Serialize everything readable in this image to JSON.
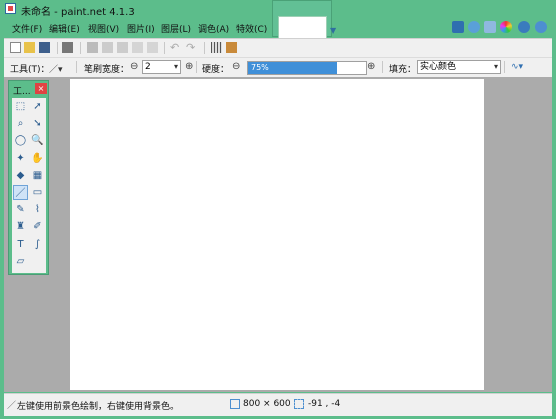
{
  "window": {
    "title": "未命名 - paint.net 4.1.3"
  },
  "menu": [
    "文件(F)",
    "编辑(E)",
    "视图(V)",
    "图片(I)",
    "图层(L)",
    "调色(A)",
    "特效(C)"
  ],
  "toolbar_icons": [
    "new-icon",
    "open-icon",
    "save-icon",
    "print-icon",
    "cut-icon",
    "copy-icon",
    "paste-icon",
    "crop-icon",
    "deselect-icon",
    "undo-icon",
    "redo-icon",
    "grid-icon",
    "ruler-icon"
  ],
  "options": {
    "tool_label": "工具(T)：",
    "brush_width_label": "笔刷宽度：",
    "brush_width_value": "2",
    "hardness_label": "硬度：",
    "hardness_value": "75%",
    "hardness_fraction": 0.75,
    "fill_label": "填充：",
    "fill_value": "实心颜色",
    "minus": "⊖",
    "plus": "⊕"
  },
  "tools_window": {
    "title": "工...",
    "close": "×"
  },
  "tools": [
    {
      "name": "rectangle-select-icon",
      "glyph": "⬚"
    },
    {
      "name": "move-selection-icon",
      "glyph": "➚"
    },
    {
      "name": "lasso-select-icon",
      "glyph": "⌕"
    },
    {
      "name": "move-selected-icon",
      "glyph": "➘"
    },
    {
      "name": "ellipse-select-icon",
      "glyph": "◯"
    },
    {
      "name": "zoom-icon",
      "glyph": "🔍"
    },
    {
      "name": "magic-wand-icon",
      "glyph": "✦"
    },
    {
      "name": "pan-icon",
      "glyph": "✋"
    },
    {
      "name": "paint-bucket-icon",
      "glyph": "◆"
    },
    {
      "name": "gradient-icon",
      "glyph": "▦"
    },
    {
      "name": "paintbrush-icon",
      "glyph": "／"
    },
    {
      "name": "eraser-icon",
      "glyph": "▭"
    },
    {
      "name": "pencil-icon",
      "glyph": "✎"
    },
    {
      "name": "color-picker-icon",
      "glyph": "⌇"
    },
    {
      "name": "clone-stamp-icon",
      "glyph": "♜"
    },
    {
      "name": "recolor-icon",
      "glyph": "✐"
    },
    {
      "name": "text-icon",
      "glyph": "T"
    },
    {
      "name": "line-curve-icon",
      "glyph": "∫"
    },
    {
      "name": "shapes-icon",
      "glyph": "▱"
    }
  ],
  "status": {
    "hint": "左键使用前景色绘制，右键使用背景色。",
    "image_size": "800 × 600",
    "cursor_position": "-91 , -4"
  }
}
